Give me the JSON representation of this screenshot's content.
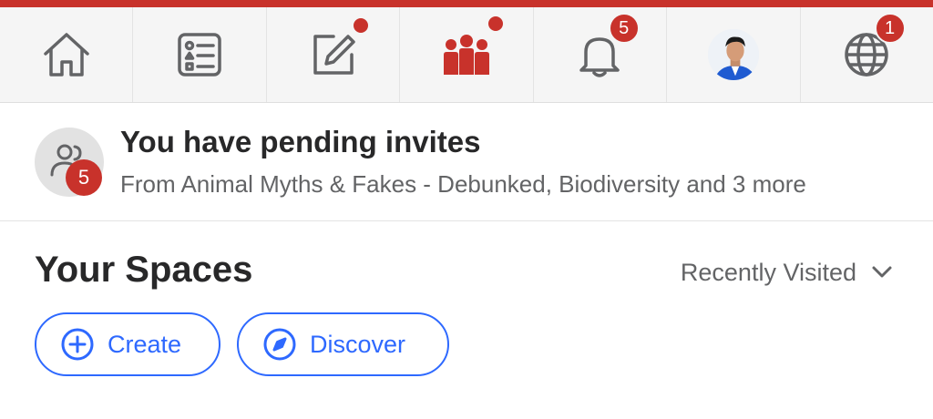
{
  "colors": {
    "brand_red": "#c8322b",
    "accent_blue": "#2e69ff",
    "icon_gray": "#636466",
    "text_dark": "#282829"
  },
  "nav": {
    "items": [
      {
        "name": "home",
        "icon": "home-icon",
        "active": false
      },
      {
        "name": "answer",
        "icon": "answer-list-icon",
        "active": false,
        "indicator": "dot"
      },
      {
        "name": "write",
        "icon": "pencil-square-icon",
        "active": false
      },
      {
        "name": "spaces",
        "icon": "people-group-icon",
        "active": true,
        "indicator": "dot"
      },
      {
        "name": "notifications",
        "icon": "bell-icon",
        "active": false,
        "badge": "5"
      },
      {
        "name": "profile",
        "icon": "user-avatar",
        "active": false
      },
      {
        "name": "language",
        "icon": "globe-icon",
        "active": false,
        "badge": "1"
      }
    ]
  },
  "invite": {
    "icon": "group-icon",
    "count": "5",
    "title": "You have pending invites",
    "subtitle": "From Animal Myths & Fakes - Debunked, Biodiversity and 3 more"
  },
  "spaces": {
    "title": "Your Spaces",
    "sort_label": "Recently Visited",
    "buttons": {
      "create": "Create",
      "discover": "Discover"
    }
  }
}
